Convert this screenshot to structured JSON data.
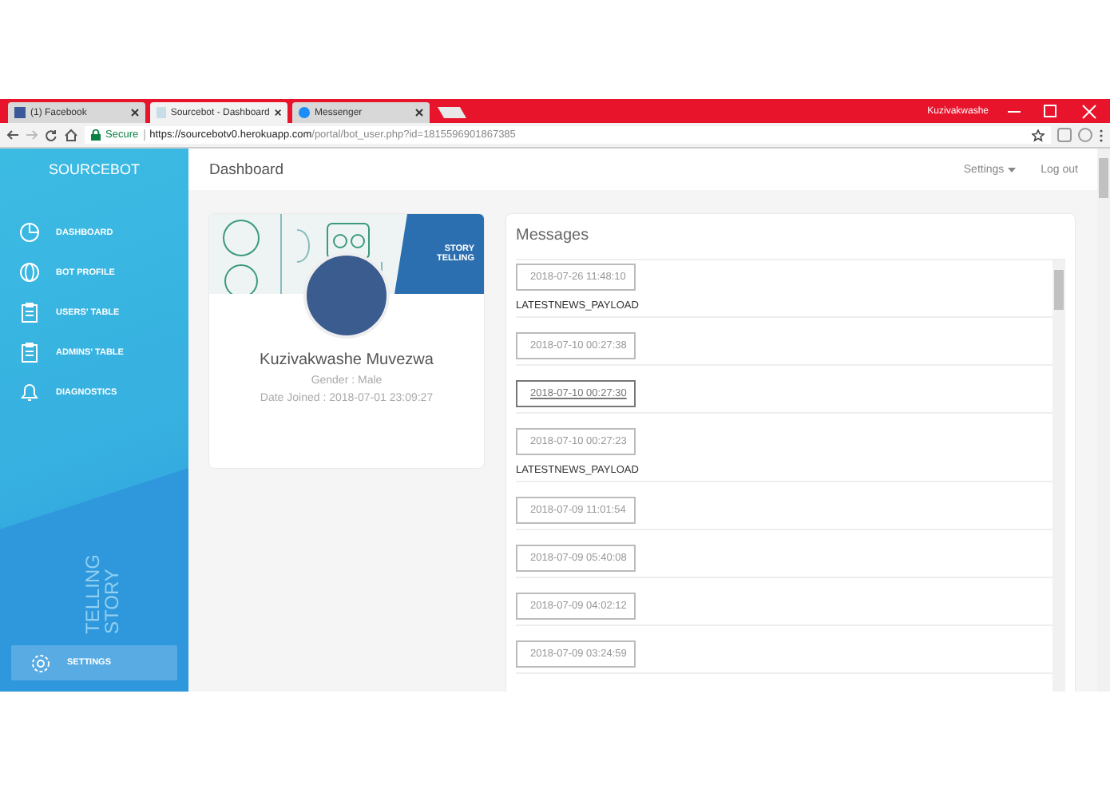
{
  "browser": {
    "tabs": [
      {
        "label": "(1) Facebook",
        "kind": "facebook",
        "selected": false
      },
      {
        "label": "Sourcebot - Dashboard",
        "kind": "page",
        "selected": true
      },
      {
        "label": "Messenger",
        "kind": "messenger",
        "selected": false
      }
    ],
    "user": "Kuzivakwashe",
    "secure_label": "Secure",
    "url_host": "https://sourcebotv0.herokuapp.com",
    "url_path": "/portal/bot_user.php?id=1815596901867385"
  },
  "sidebar": {
    "brand": "SOURCEBOT",
    "items": [
      {
        "label": "DASHBOARD",
        "selected": false
      },
      {
        "label": "BOT PROFILE",
        "selected": false
      },
      {
        "label": "USERS' TABLE",
        "selected": false
      },
      {
        "label": "ADMINS' TABLE",
        "selected": false
      },
      {
        "label": "DIAGNOSTICS",
        "selected": false
      }
    ],
    "backdrop_lines": [
      "STORY",
      "TELLING"
    ],
    "bottom_item": {
      "label": "SETTINGS",
      "selected": true
    }
  },
  "header": {
    "title": "Dashboard",
    "settings": "Settings",
    "logout": "Log out"
  },
  "profile": {
    "banner_lines": [
      "STORY",
      "TELLING"
    ],
    "name": "Kuzivakwashe Muvezwa",
    "gender": "Gender : Male",
    "joined": "Date Joined : 2018-07-01 23:09:27"
  },
  "messages": {
    "title": "Messages",
    "items": [
      {
        "time": "2018-07-26 11:48:10",
        "text": "LATESTNEWS_PAYLOAD",
        "selected": false
      },
      {
        "time": "2018-07-10 00:27:38",
        "selected": false
      },
      {
        "time": "2018-07-10 00:27:30",
        "selected": true
      },
      {
        "time": "2018-07-10 00:27:23",
        "text": "LATESTNEWS_PAYLOAD",
        "selected": false
      },
      {
        "time": "2018-07-09 11:01:54",
        "selected": false
      },
      {
        "time": "2018-07-09 05:40:08",
        "selected": false
      },
      {
        "time": "2018-07-09 04:02:12",
        "selected": false
      },
      {
        "time": "2018-07-09 03:24:59",
        "selected": false
      }
    ]
  }
}
